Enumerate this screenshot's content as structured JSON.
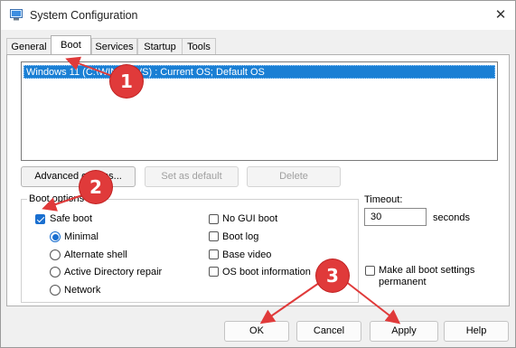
{
  "window": {
    "title": "System Configuration",
    "close_glyph": "✕"
  },
  "tabs": [
    {
      "label": "General"
    },
    {
      "label": "Boot"
    },
    {
      "label": "Services"
    },
    {
      "label": "Startup"
    },
    {
      "label": "Tools"
    }
  ],
  "os_list": {
    "items": [
      "Windows 11 (C:\\WINDOWS) : Current OS; Default OS"
    ]
  },
  "os_buttons": {
    "advanced_options": "Advanced options...",
    "set_as_default": "Set as default",
    "delete": "Delete"
  },
  "boot_options": {
    "legend": "Boot options",
    "safe_boot": {
      "label": "Safe boot",
      "checked": true
    },
    "modes": [
      {
        "label": "Minimal",
        "selected": true
      },
      {
        "label": "Alternate shell",
        "selected": false
      },
      {
        "label": "Active Directory repair",
        "selected": false
      },
      {
        "label": "Network",
        "selected": false
      }
    ],
    "options": [
      {
        "label": "No GUI boot",
        "checked": false
      },
      {
        "label": "Boot log",
        "checked": false
      },
      {
        "label": "Base video",
        "checked": false
      },
      {
        "label": "OS boot information",
        "checked": false
      }
    ]
  },
  "timeout": {
    "label": "Timeout:",
    "value": "30",
    "unit": "seconds"
  },
  "make_permanent": {
    "label_line1": "Make all boot settings",
    "label_line2": "permanent",
    "checked": false
  },
  "bottom_buttons": {
    "ok": "OK",
    "cancel": "Cancel",
    "apply": "Apply",
    "help": "Help"
  },
  "annotations": {
    "color": "#e03a3a",
    "badges": [
      "1",
      "2",
      "3"
    ]
  }
}
